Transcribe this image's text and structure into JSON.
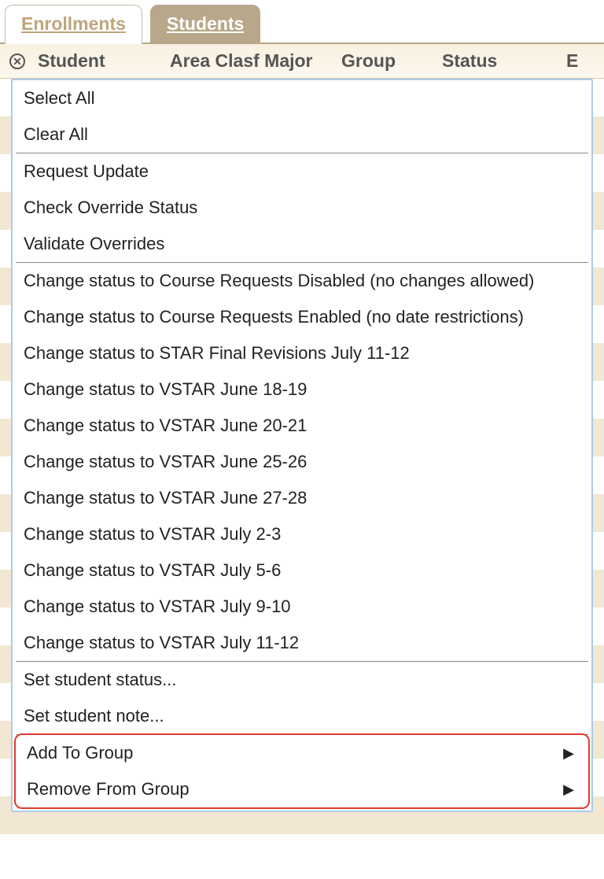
{
  "tabs": {
    "enrollments": "Enrollments",
    "students": "Students"
  },
  "columns": {
    "student": "Student",
    "area": "Area Clasf Major",
    "group": "Group",
    "status": "Status",
    "e": "E"
  },
  "menu": {
    "select_all": "Select All",
    "clear_all": "Clear All",
    "request_update": "Request Update",
    "check_override_status": "Check Override Status",
    "validate_overrides": "Validate Overrides",
    "status_items": [
      "Change status to Course Requests Disabled (no changes allowed)",
      "Change status to Course Requests Enabled (no date restrictions)",
      "Change status to STAR Final Revisions July 11-12",
      "Change status to VSTAR June 18-19",
      "Change status to VSTAR June 20-21",
      "Change status to VSTAR June 25-26",
      "Change status to VSTAR June 27-28",
      "Change status to VSTAR July 2-3",
      "Change status to VSTAR July 5-6",
      "Change status to VSTAR July 9-10",
      "Change status to VSTAR July 11-12"
    ],
    "set_student_status": "Set student status...",
    "set_student_note": "Set student note...",
    "add_to_group": "Add To Group",
    "remove_from_group": "Remove From Group"
  }
}
